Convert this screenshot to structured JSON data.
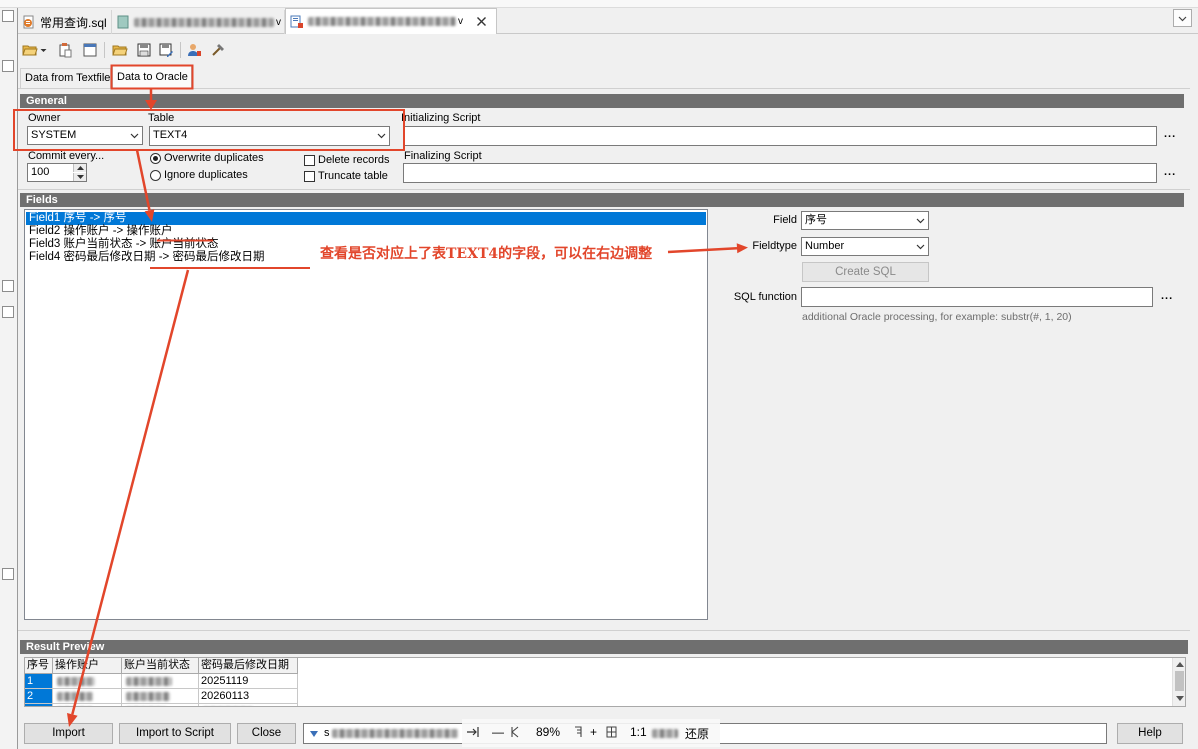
{
  "colors": {
    "selection": "#0078d7",
    "section_header": "#6f6f6f",
    "annotation": "#e2462b"
  },
  "editor_tabs": [
    {
      "label": "常用查询.sql",
      "icon": "sql-file-icon"
    },
    {
      "label_tail": "v",
      "icon": "csv-file-icon"
    },
    {
      "label_tail": "v",
      "icon": "text-importer-icon",
      "active": true
    }
  ],
  "toolbar_icons": [
    "open-file-icon",
    "paste-icon",
    "new-icon",
    "open-folder-icon",
    "save-icon",
    "save-as-icon",
    "user-icon",
    "tools-icon"
  ],
  "importer_tabs": [
    {
      "label": "Data from Textfile"
    },
    {
      "label": "Data to Oracle",
      "active": true
    }
  ],
  "general": {
    "title": "General",
    "owner_label": "Owner",
    "owner_value": "SYSTEM",
    "table_label": "Table",
    "table_value": "TEXT4",
    "init_script_label": "Initializing Script",
    "commit_label": "Commit every...",
    "commit_value": "100",
    "overwrite_label": "Overwrite duplicates",
    "overwrite_checked": true,
    "ignore_label": "Ignore duplicates",
    "ignore_checked": false,
    "delete_label": "Delete records",
    "delete_checked": false,
    "truncate_label": "Truncate table",
    "truncate_checked": false,
    "final_script_label": "Finalizing Script",
    "browse_label": "..."
  },
  "fields": {
    "title": "Fields",
    "items": [
      {
        "label": "Field1 序号 -> 序号",
        "selected": true
      },
      {
        "label": "Field2 操作账户 -> 操作账户",
        "selected": false
      },
      {
        "label": "Field3 账户当前状态 -> 账户当前状态",
        "selected": false
      },
      {
        "label": "Field4 密码最后修改日期 -> 密码最后修改日期",
        "selected": false
      }
    ]
  },
  "field_detail": {
    "field_label": "Field",
    "field_value": "序号",
    "fieldtype_label": "Fieldtype",
    "fieldtype_value": "Number",
    "create_sql_label": "Create SQL",
    "sql_function_label": "SQL function",
    "browse_label": "...",
    "hint": "additional Oracle processing, for example: substr(#, 1, 20)"
  },
  "annotation": {
    "note": "查看是否对应上了表TEXT4的字段，可以在右边调整"
  },
  "result_preview": {
    "title": "Result Preview",
    "columns": [
      "序号",
      "操作账户",
      "账户当前状态",
      "密码最后修改日期"
    ],
    "rows": [
      {
        "num": "1",
        "last_changed": "20251119"
      },
      {
        "num": "2",
        "last_changed": "20260113"
      }
    ]
  },
  "footer": {
    "import_label": "Import",
    "import_to_script_label": "Import to Script",
    "close_label": "Close",
    "target_head": "s",
    "help_label": "Help"
  },
  "viewer_overlay": {
    "minus": "—",
    "zoom": "89%",
    "plus": "+",
    "ratio": "1:1",
    "restore": "还原"
  }
}
